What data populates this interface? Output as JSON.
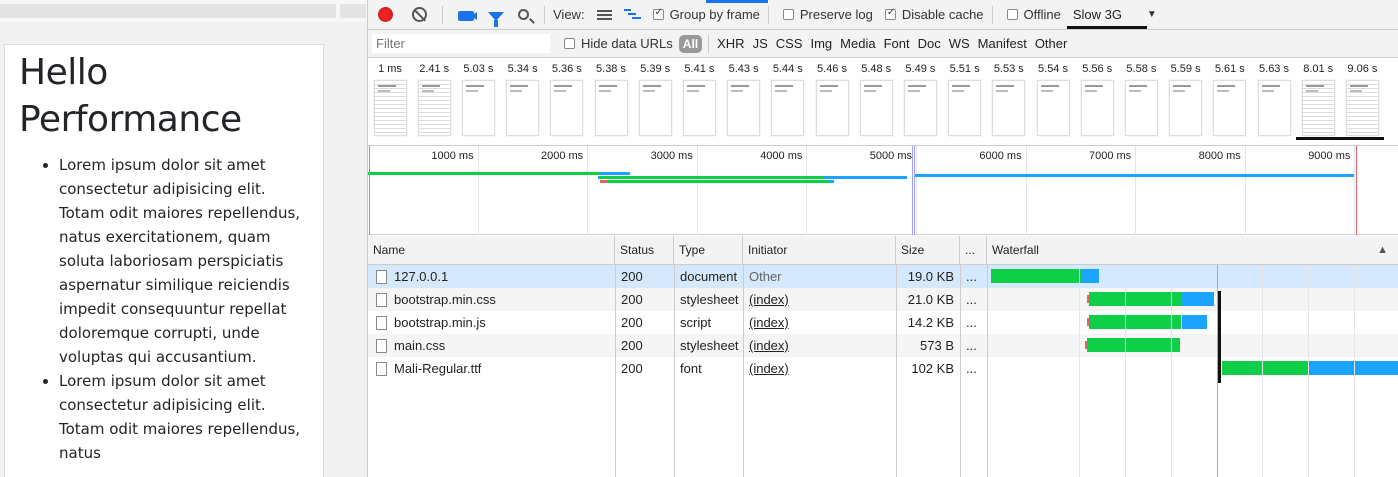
{
  "page": {
    "title": "Hello Performance",
    "items": [
      "Lorem ipsum dolor sit amet consectetur adipisicing elit. Totam odit maiores repellendus, natus exercitationem, quam soluta laboriosam perspiciatis aspernatur similique reiciendis impedit consequuntur repellat doloremque corrupti, unde voluptas qui accusantium.",
      "Lorem ipsum dolor sit amet consectetur adipisicing elit. Totam odit maiores repellendus, natus"
    ]
  },
  "toolbar": {
    "view_label": "View:",
    "group_by_frame": "Group by frame",
    "preserve_log": "Preserve log",
    "disable_cache": "Disable cache",
    "offline": "Offline",
    "throttling": "Slow 3G",
    "group_by_frame_checked": true,
    "preserve_log_checked": false,
    "disable_cache_checked": true,
    "offline_checked": false
  },
  "filter": {
    "placeholder": "Filter",
    "hide_data_urls": "Hide data URLs",
    "types": [
      "All",
      "XHR",
      "JS",
      "CSS",
      "Img",
      "Media",
      "Font",
      "Doc",
      "WS",
      "Manifest",
      "Other"
    ]
  },
  "filmstrip": [
    "1 ms",
    "2.41 s",
    "5.03 s",
    "5.34 s",
    "5.36 s",
    "5.38 s",
    "5.39 s",
    "5.41 s",
    "5.43 s",
    "5.44 s",
    "5.46 s",
    "5.48 s",
    "5.49 s",
    "5.51 s",
    "5.53 s",
    "5.54 s",
    "5.56 s",
    "5.58 s",
    "5.59 s",
    "5.61 s",
    "5.63 s",
    "8.01 s",
    "9.06 s"
  ],
  "overview_ticks": [
    "1000 ms",
    "2000 ms",
    "3000 ms",
    "4000 ms",
    "5000 ms",
    "6000 ms",
    "7000 ms",
    "8000 ms",
    "9000 ms"
  ],
  "columns": {
    "name": "Name",
    "status": "Status",
    "type": "Type",
    "initiator": "Initiator",
    "size": "Size",
    "more": "...",
    "waterfall": "Waterfall",
    "sort_icon": "▲"
  },
  "rows": [
    {
      "name": "127.0.0.1",
      "status": "200",
      "type": "document",
      "initiator": "Other",
      "size": "19.0 KB",
      "more": "..."
    },
    {
      "name": "bootstrap.min.css",
      "status": "200",
      "type": "stylesheet",
      "initiator": "(index)",
      "size": "21.0 KB",
      "more": "..."
    },
    {
      "name": "bootstrap.min.js",
      "status": "200",
      "type": "script",
      "initiator": "(index)",
      "size": "14.2 KB",
      "more": "..."
    },
    {
      "name": "main.css",
      "status": "200",
      "type": "stylesheet",
      "initiator": "(index)",
      "size": "573 B",
      "more": "..."
    },
    {
      "name": "Mali-Regular.ttf",
      "status": "200",
      "type": "font",
      "initiator": "(index)",
      "size": "102 KB",
      "more": "..."
    }
  ]
}
